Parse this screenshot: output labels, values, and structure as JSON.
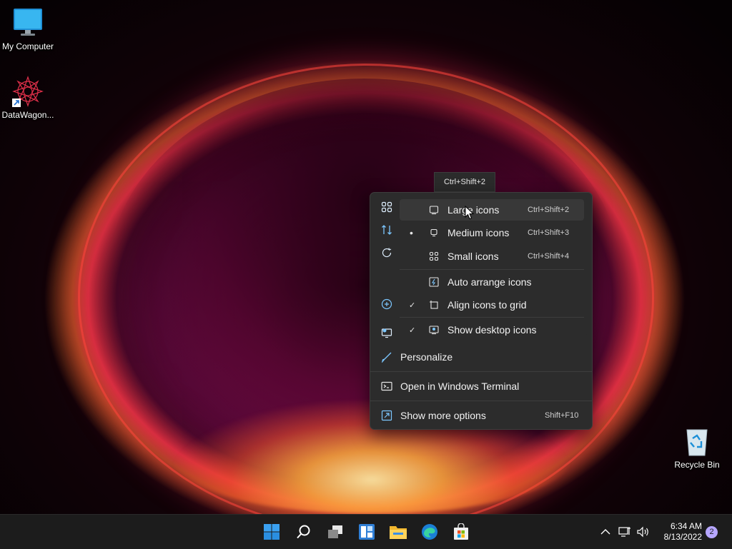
{
  "desktop": {
    "icons": [
      {
        "label": "My Computer",
        "icon": "monitor-icon"
      },
      {
        "label": "DataWagon...",
        "icon": "datawagon-app-icon"
      },
      {
        "label": "Recycle Bin",
        "icon": "recycle-bin-icon"
      }
    ]
  },
  "tooltip": {
    "text": "Ctrl+Shift+2"
  },
  "context_menu": {
    "view_submenu": [
      {
        "label": "Large icons",
        "shortcut": "Ctrl+Shift+2",
        "icon": "large-icons-icon",
        "mark": "",
        "highlighted": true
      },
      {
        "label": "Medium icons",
        "shortcut": "Ctrl+Shift+3",
        "icon": "medium-icons-icon",
        "mark": "•"
      },
      {
        "label": "Small icons",
        "shortcut": "Ctrl+Shift+4",
        "icon": "small-icons-icon",
        "mark": ""
      },
      {
        "label": "Auto arrange icons",
        "shortcut": "",
        "icon": "auto-arrange-icon",
        "mark": ""
      },
      {
        "label": "Align icons to grid",
        "shortcut": "",
        "icon": "align-grid-icon",
        "mark": "✓"
      },
      {
        "label": "Show desktop icons",
        "shortcut": "",
        "icon": "show-desktop-icons-icon",
        "mark": "✓"
      }
    ],
    "personalize": {
      "label": "Personalize"
    },
    "terminal": {
      "label": "Open in Windows Terminal"
    },
    "more_options": {
      "label": "Show more options",
      "shortcut": "Shift+F10"
    }
  },
  "taskbar": {
    "apps": [
      "start-icon",
      "search-icon",
      "task-view-icon",
      "widgets-icon",
      "file-explorer-icon",
      "edge-icon",
      "store-icon"
    ],
    "tray": [
      "chevron-up-icon",
      "network-icon",
      "volume-icon"
    ],
    "time": "6:34 AM",
    "date": "8/13/2022",
    "notification_count": "2"
  }
}
